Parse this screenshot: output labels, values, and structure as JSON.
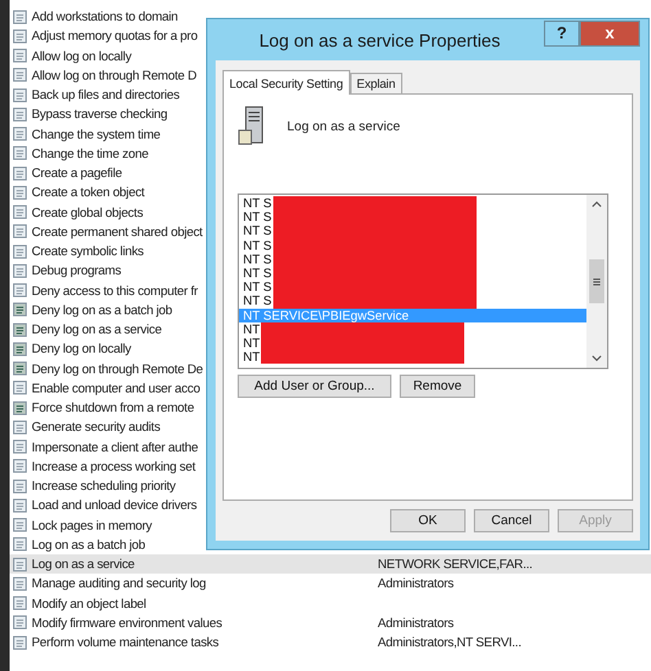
{
  "policy_list": {
    "rows": [
      {
        "policy": "Add workstations to domain",
        "kind": "policy",
        "selected": false
      },
      {
        "policy": "Adjust memory quotas for a pro",
        "kind": "policy",
        "selected": false
      },
      {
        "policy": "Allow log on locally",
        "kind": "policy",
        "selected": false
      },
      {
        "policy": "Allow log on through Remote D",
        "kind": "policy",
        "selected": false
      },
      {
        "policy": "Back up files and directories",
        "kind": "policy",
        "selected": false
      },
      {
        "policy": "Bypass traverse checking",
        "kind": "policy",
        "selected": false
      },
      {
        "policy": "Change the system time",
        "kind": "policy",
        "selected": false
      },
      {
        "policy": "Change the time zone",
        "kind": "policy",
        "selected": false
      },
      {
        "policy": "Create a pagefile",
        "kind": "policy",
        "selected": false
      },
      {
        "policy": "Create a token object",
        "kind": "policy",
        "selected": false
      },
      {
        "policy": "Create global objects",
        "kind": "policy",
        "selected": false
      },
      {
        "policy": "Create permanent shared object",
        "kind": "policy",
        "selected": false
      },
      {
        "policy": "Create symbolic links",
        "kind": "policy",
        "selected": false
      },
      {
        "policy": "Debug programs",
        "kind": "policy",
        "selected": false
      },
      {
        "policy": "Deny access to this computer fr",
        "kind": "policy",
        "selected": false
      },
      {
        "policy": "Deny log on as a batch job",
        "kind": "deny",
        "selected": false
      },
      {
        "policy": "Deny log on as a service",
        "kind": "deny",
        "selected": false
      },
      {
        "policy": "Deny log on locally",
        "kind": "deny",
        "selected": false
      },
      {
        "policy": "Deny log on through Remote De",
        "kind": "deny",
        "selected": false
      },
      {
        "policy": "Enable computer and user acco",
        "kind": "policy",
        "selected": false
      },
      {
        "policy": "Force shutdown from a remote",
        "kind": "deny",
        "selected": false
      },
      {
        "policy": "Generate security audits",
        "kind": "policy",
        "selected": false
      },
      {
        "policy": "Impersonate a client after authe",
        "kind": "policy",
        "selected": false
      },
      {
        "policy": "Increase a process working set",
        "kind": "policy",
        "selected": false
      },
      {
        "policy": "Increase scheduling priority",
        "kind": "policy",
        "selected": false
      },
      {
        "policy": "Load and unload device drivers",
        "kind": "policy",
        "selected": false
      },
      {
        "policy": "Lock pages in memory",
        "kind": "policy",
        "selected": false
      },
      {
        "policy": "Log on as a batch job",
        "kind": "policy",
        "selected": false
      },
      {
        "policy": "Log on as a service",
        "kind": "policy",
        "selected": true,
        "setting": "NETWORK SERVICE,FAR..."
      },
      {
        "policy": "Manage auditing and security log",
        "kind": "policy",
        "selected": false,
        "setting": "Administrators"
      },
      {
        "policy": "Modify an object label",
        "kind": "policy",
        "selected": false
      },
      {
        "policy": "Modify firmware environment values",
        "kind": "policy",
        "selected": false,
        "setting": "Administrators"
      },
      {
        "policy": "Perform volume maintenance tasks",
        "kind": "policy",
        "selected": false,
        "setting": "Administrators,NT SERVI..."
      }
    ]
  },
  "dialog": {
    "title": "Log on as a service Properties",
    "help": "?",
    "close": "x",
    "tabs": [
      {
        "label": "Local Security Setting",
        "selected": true
      },
      {
        "label": "Explain",
        "selected": false
      }
    ],
    "policy_name": "Log on as a service",
    "accounts": [
      {
        "label": "NT S",
        "selected": false,
        "redacted": true
      },
      {
        "label": "NT S",
        "selected": false,
        "redacted": true
      },
      {
        "label": "NT S",
        "selected": false,
        "redacted": true
      },
      {
        "label": "NT S",
        "selected": false,
        "redacted": true
      },
      {
        "label": "NT S",
        "selected": false,
        "redacted": true
      },
      {
        "label": "NT S",
        "selected": false,
        "redacted": true
      },
      {
        "label": "NT S",
        "selected": false,
        "redacted": true
      },
      {
        "label": "NT S",
        "selected": false,
        "redacted": true
      },
      {
        "label": "NT SERVICE\\PBIEgwService",
        "selected": true,
        "redacted": false
      },
      {
        "label": "NT",
        "selected": false,
        "redacted": true
      },
      {
        "label": "NT",
        "selected": false,
        "redacted": true
      },
      {
        "label": "NT",
        "selected": false,
        "redacted": true
      }
    ],
    "list_buttons": [
      "Add User or Group...",
      "Remove"
    ],
    "buttons": [
      {
        "label": "OK",
        "disabled": false
      },
      {
        "label": "Cancel",
        "disabled": false
      },
      {
        "label": "Apply",
        "disabled": true
      }
    ]
  }
}
